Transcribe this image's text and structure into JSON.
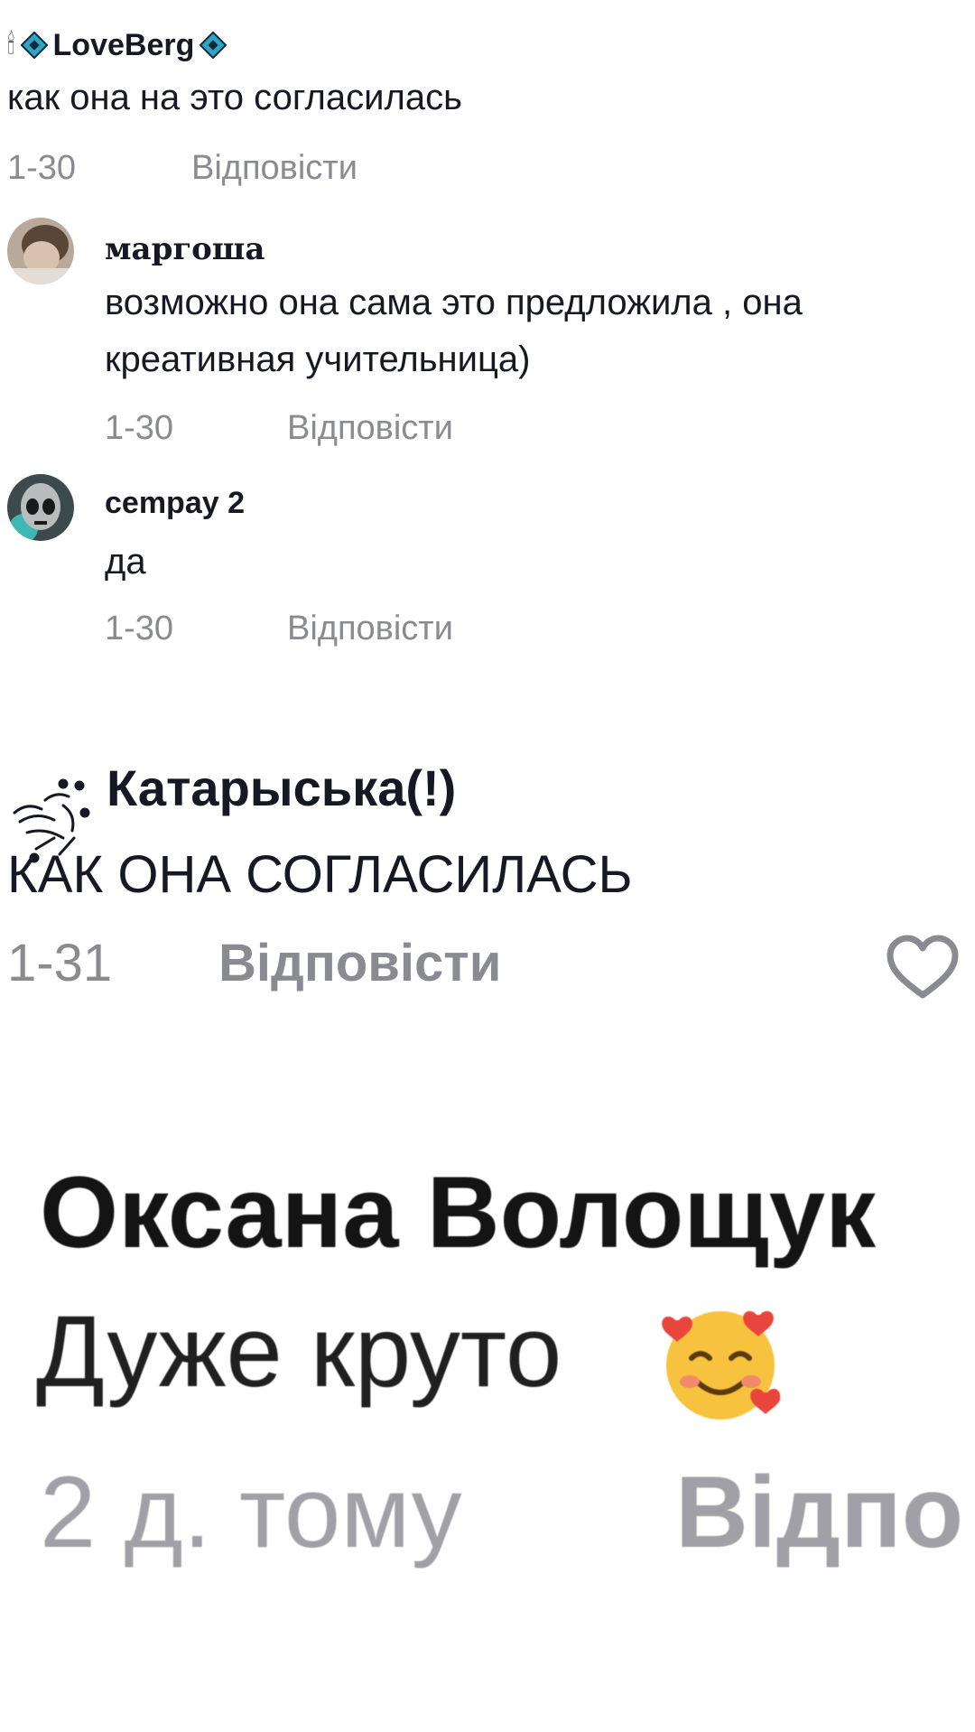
{
  "comments": [
    {
      "author": "LoveBerg",
      "author_prefix": "🕯",
      "author_decoration_icon": "diamond-badge-icon",
      "text": "как она на это согласилась",
      "date": "1-30",
      "reply_label": "Відповісти",
      "replies": [
        {
          "author": "маргоша",
          "avatar_icon": "user-avatar",
          "text_lines": [
            "возможно она сама это предложила , она",
            "креативная учительница)"
          ],
          "date": "1-30",
          "reply_label": "Відповісти"
        },
        {
          "author": "cempay 2",
          "avatar_icon": "alien-avatar",
          "text": "да",
          "date": "1-30",
          "reply_label": "Відповісти"
        }
      ]
    },
    {
      "author": "Катарыська(!)",
      "author_decoration_icon": "sparkle-doodle-icon",
      "text": "КАК ОНА СОГЛАСИЛАСЬ",
      "date": "1-31",
      "reply_label": "Відповісти",
      "like_icon": "heart-outline-icon"
    },
    {
      "author": "Оксана Волощук",
      "text": "Дуже круто",
      "emoji_icon": "smiling-face-with-hearts-icon",
      "date": "2 д. тому",
      "reply_label": "Відпо"
    }
  ],
  "colors": {
    "text": "#161823",
    "meta": "#8a8b91",
    "diamond": "#2fa4c4",
    "background": "#ffffff"
  }
}
